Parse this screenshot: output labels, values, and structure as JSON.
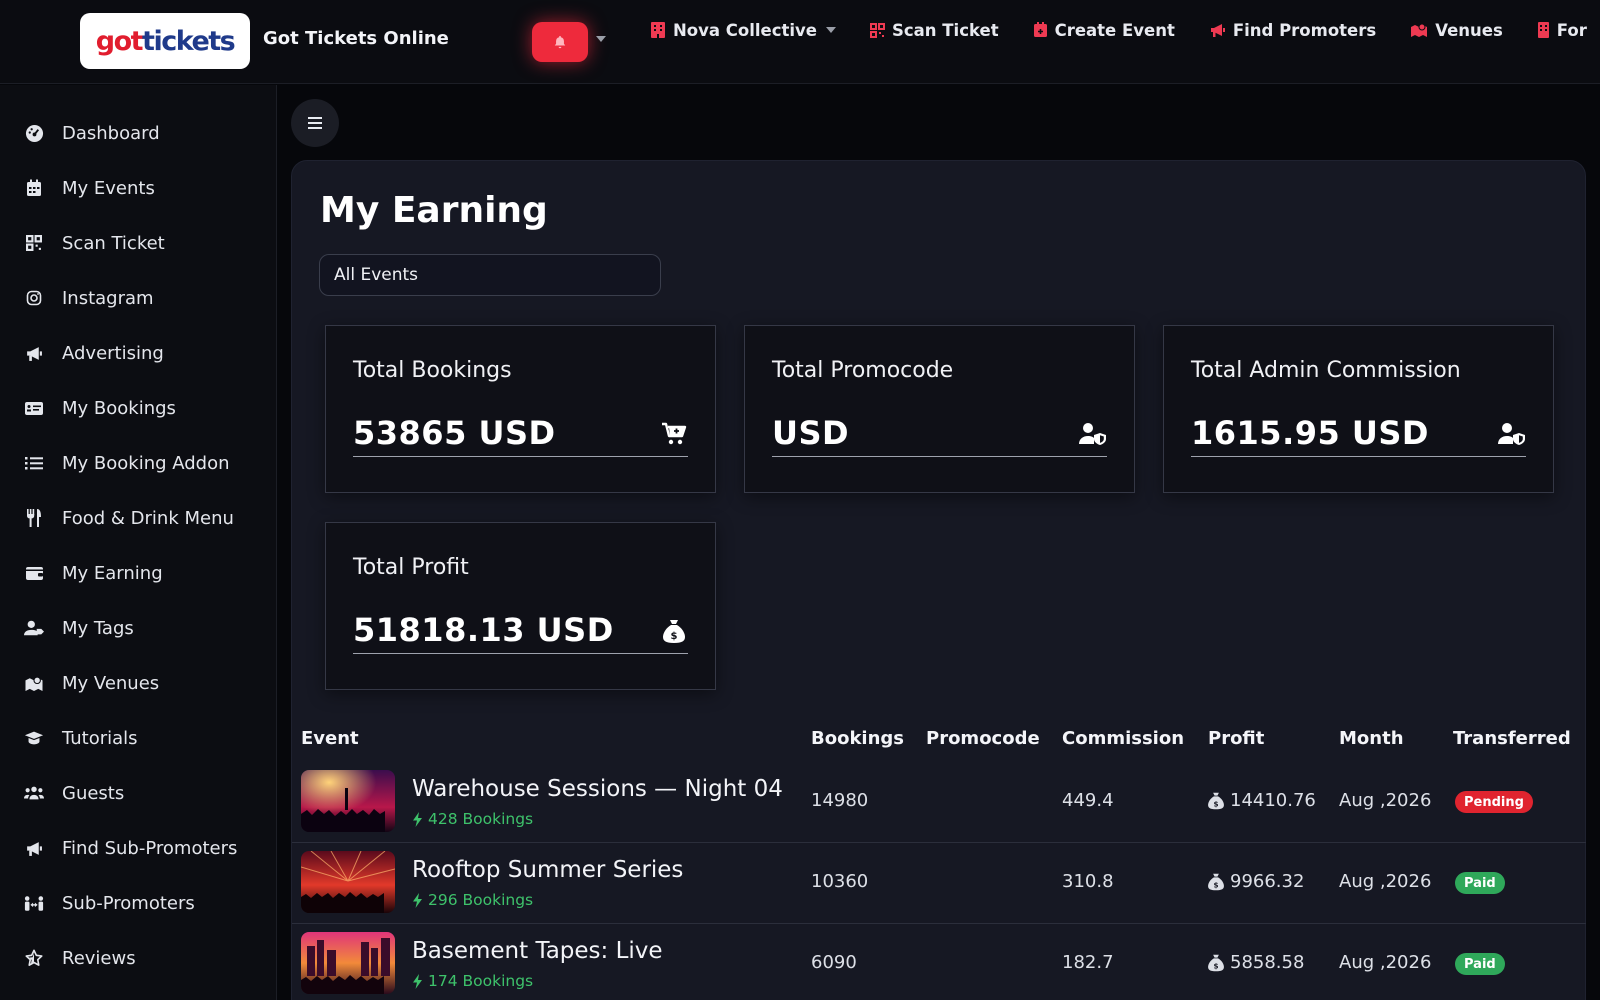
{
  "header": {
    "logo_part1": "got",
    "logo_part2": "tickets",
    "brand_name": "Got Tickets Online",
    "nav": [
      {
        "label": "Nova Collective",
        "icon": "building-icon"
      },
      {
        "label": "Scan Ticket",
        "icon": "qrcode-icon"
      },
      {
        "label": "Create Event",
        "icon": "calendar-plus-icon"
      },
      {
        "label": "Find Promoters",
        "icon": "megaphone-icon"
      },
      {
        "label": "Venues",
        "icon": "map-location-icon"
      },
      {
        "label": "For",
        "icon": "building-icon"
      }
    ]
  },
  "sidebar": {
    "items": [
      {
        "label": "Dashboard",
        "icon": "gauge-icon"
      },
      {
        "label": "My Events",
        "icon": "calendar-icon"
      },
      {
        "label": "Scan Ticket",
        "icon": "qrcode-icon"
      },
      {
        "label": "Instagram",
        "icon": "instagram-icon"
      },
      {
        "label": "Advertising",
        "icon": "megaphone-icon"
      },
      {
        "label": "My Bookings",
        "icon": "ticket-card-icon"
      },
      {
        "label": "My Booking Addon",
        "icon": "list-icon"
      },
      {
        "label": "Food & Drink Menu",
        "icon": "utensils-icon"
      },
      {
        "label": "My Earning",
        "icon": "wallet-icon"
      },
      {
        "label": "My Tags",
        "icon": "user-tag-icon"
      },
      {
        "label": "My Venues",
        "icon": "map-location-icon"
      },
      {
        "label": "Tutorials",
        "icon": "graduation-cap-icon"
      },
      {
        "label": "Guests",
        "icon": "users-icon"
      },
      {
        "label": "Find Sub-Promoters",
        "icon": "megaphone-icon"
      },
      {
        "label": "Sub-Promoters",
        "icon": "people-arrows-icon"
      },
      {
        "label": "Reviews",
        "icon": "star-icon"
      }
    ]
  },
  "main": {
    "title": "My Earning",
    "event_filter": "All Events",
    "cards": [
      {
        "label": "Total Bookings",
        "value": "53865 USD",
        "icon": "cart-plus-icon"
      },
      {
        "label": "Total Promocode",
        "value": "USD",
        "icon": "user-shield-icon"
      },
      {
        "label": "Total Admin Commission",
        "value": "1615.95 USD",
        "icon": "user-shield-icon"
      },
      {
        "label": "Total Profit",
        "value": "51818.13 USD",
        "icon": "money-bag-icon"
      }
    ],
    "table": {
      "columns": [
        "Event",
        "Bookings",
        "Promocode",
        "Commission",
        "Profit",
        "Month",
        "Transferred"
      ],
      "rows": [
        {
          "event": "Warehouse Sessions — Night 04",
          "sub": "428 Bookings",
          "bookings": "14980",
          "promocode": "",
          "commission": "449.4",
          "profit": "14410.76",
          "month": "Aug ,2026",
          "transferred": "Pending",
          "status": "pending"
        },
        {
          "event": "Rooftop Summer Series",
          "sub": "296 Bookings",
          "bookings": "10360",
          "promocode": "",
          "commission": "310.8",
          "profit": "9966.32",
          "month": "Aug ,2026",
          "transferred": "Paid",
          "status": "paid"
        },
        {
          "event": "Basement Tapes: Live",
          "sub": "174 Bookings",
          "bookings": "6090",
          "promocode": "",
          "commission": "182.7",
          "profit": "5858.58",
          "month": "Aug ,2026",
          "transferred": "Paid",
          "status": "paid"
        }
      ]
    }
  },
  "colors": {
    "accent": "#ee2a3c",
    "success": "#3ec26b",
    "pending": "#e0242f",
    "paid": "#2fa85a"
  }
}
